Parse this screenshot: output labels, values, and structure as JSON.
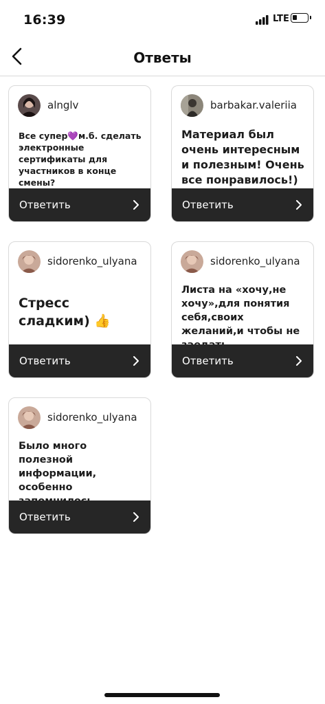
{
  "status_bar": {
    "time": "16:39",
    "network": "LTE",
    "battery_level": 0.3
  },
  "header": {
    "title": "Ответы",
    "back_icon": "chevron-left-icon"
  },
  "reply_label": "Ответить",
  "cards": [
    {
      "username": "alnglv",
      "message": "Все супер💜м.б. сделать электронные сертификаты для участников в конце смены?",
      "avatar_color": "#3a2a2a"
    },
    {
      "username": "barbakar.valeriia",
      "message": "Материал был очень интересным и полезным! Очень все понравилось!)",
      "avatar_color": "#6f6a60"
    },
    {
      "username": "sidorenko_ulyana",
      "message": "Стресс сладким) 👍",
      "avatar_color": "#b88d7a"
    },
    {
      "username": "sidorenko_ulyana",
      "message": "Листа на «хочу,не хочу»,для понятия себя,своих желаний,и чтобы не заедать",
      "avatar_color": "#b88d7a"
    },
    {
      "username": "sidorenko_ulyana",
      "message": "Было много полезной информации, особенно запомнилось разделение",
      "avatar_color": "#b88d7a"
    }
  ]
}
